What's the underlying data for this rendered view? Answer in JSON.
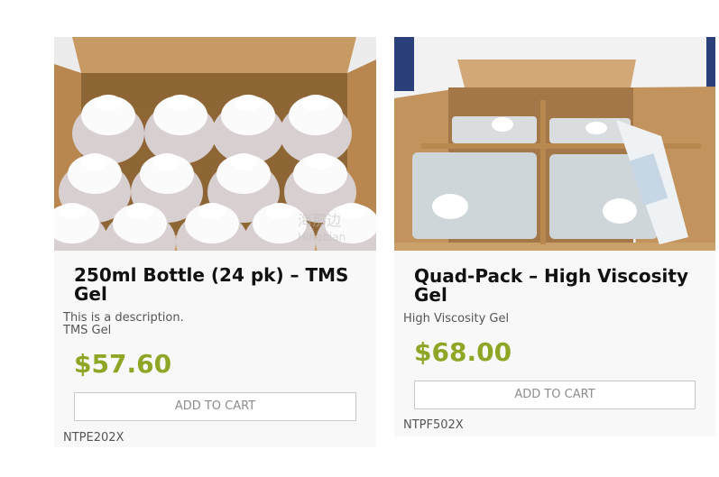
{
  "products": [
    {
      "image_alt": "Box of 24 gel bottles",
      "title": "250ml Bottle (24 pk) – TMS Gel",
      "description": "This is a description.\nTMS Gel",
      "price": "$57.60",
      "cart_label": "ADD TO CART",
      "sku": "NTPE202X"
    },
    {
      "image_alt": "Box of four gel jugs with pump bottle",
      "title": "Quad-Pack – High Viscosity Gel",
      "description": "High Viscosity Gel",
      "price": "$68.00",
      "cart_label": "ADD TO CART",
      "sku": "NTPF502X"
    }
  ],
  "watermark": {
    "text": "海那边",
    "sub": "Hinabian"
  },
  "colors": {
    "price": "#8ea625",
    "card_bg": "#f8f8f8",
    "button_border": "#c8c8c8"
  }
}
